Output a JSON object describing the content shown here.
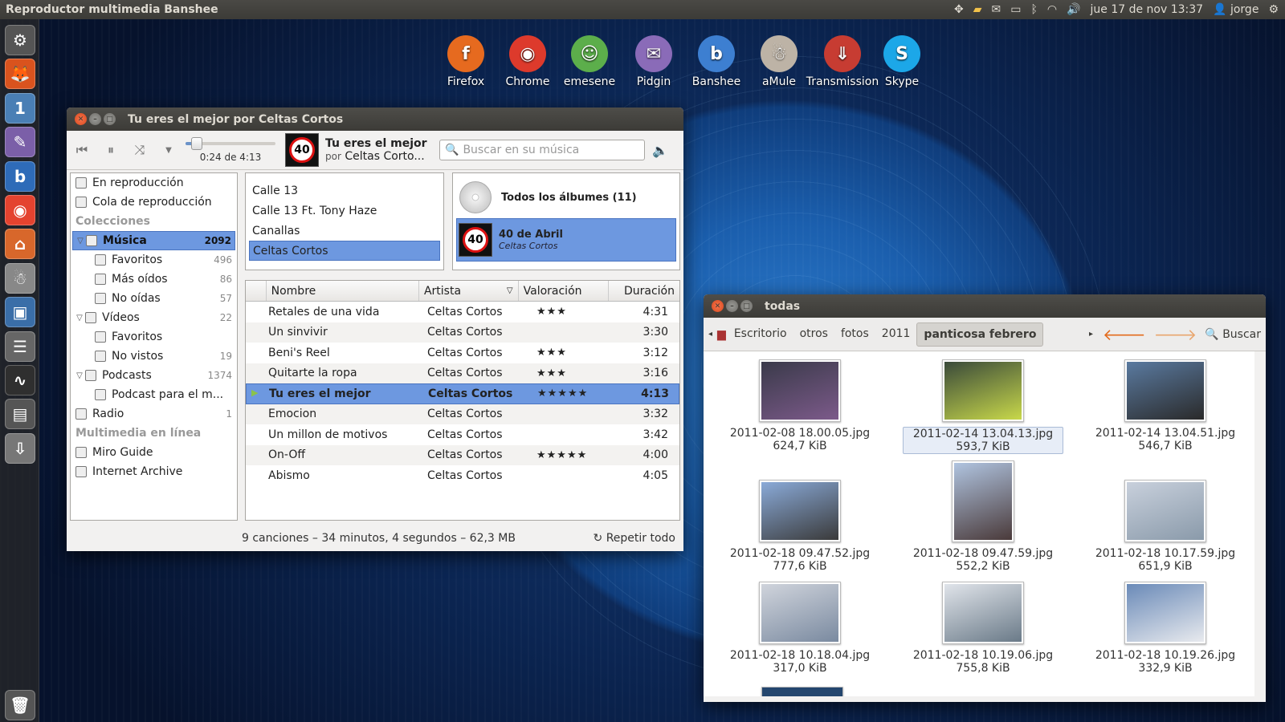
{
  "panel": {
    "app_name": "Reproductor multimedia Banshee",
    "datetime": "jue 17 de nov 13:37",
    "user": "jorge"
  },
  "launcher": {
    "items": [
      {
        "icon": "settings-icon",
        "glyph": "⚙",
        "color": "#555"
      },
      {
        "icon": "firefox-icon",
        "glyph": "🦊",
        "color": "#d9531e"
      },
      {
        "icon": "messaging-icon",
        "glyph": "1",
        "color": "#4a7fb5"
      },
      {
        "icon": "pidgin-icon",
        "glyph": "✎",
        "color": "#7b5fa8"
      },
      {
        "icon": "banshee-icon",
        "glyph": "b",
        "color": "#2e6bb8"
      },
      {
        "icon": "chrome-icon",
        "glyph": "◉",
        "color": "#e4432f"
      },
      {
        "icon": "home-folder-icon",
        "glyph": "⌂",
        "color": "#d8672b"
      },
      {
        "icon": "amule-icon",
        "glyph": "☃",
        "color": "#888"
      },
      {
        "icon": "screenshot-icon",
        "glyph": "▣",
        "color": "#3a6ea8"
      },
      {
        "icon": "disk-icon",
        "glyph": "☰",
        "color": "#666"
      },
      {
        "icon": "system-monitor-icon",
        "glyph": "∿",
        "color": "#2f2f2f"
      },
      {
        "icon": "terminal-icon",
        "glyph": "▤",
        "color": "#555"
      },
      {
        "icon": "installer-icon",
        "glyph": "⇩",
        "color": "#777"
      }
    ],
    "trash_icon": "trash-icon"
  },
  "desktop_icons": [
    {
      "label": "Firefox",
      "color": "#e66a1f",
      "glyph": "f"
    },
    {
      "label": "Chrome",
      "color": "#dd3a2c",
      "glyph": "◉"
    },
    {
      "label": "emesene",
      "color": "#5cae4b",
      "glyph": "☺"
    },
    {
      "label": "Pidgin",
      "color": "#8a6bb8",
      "glyph": "✉"
    },
    {
      "label": "Banshee",
      "color": "#3d7fd1",
      "glyph": "b"
    },
    {
      "label": "aMule",
      "color": "#bdb3a6",
      "glyph": "☃"
    },
    {
      "label": "Transmission",
      "color": "#c73c32",
      "glyph": "⇓"
    },
    {
      "label": "Skype",
      "color": "#1ca7e8",
      "glyph": "S"
    }
  ],
  "banshee": {
    "title": "Tu eres el mejor por Celtas Cortos",
    "now_playing": {
      "title": "Tu eres el mejor",
      "by": "por",
      "artist": "Celtas Corto...",
      "time": "0:24 de 4:13",
      "progress": 0.095,
      "cover": "40"
    },
    "search_placeholder": "Buscar en su música",
    "sources": [
      {
        "label": "En reproducción",
        "level": 0,
        "count": "",
        "type": "item"
      },
      {
        "label": "Cola de reproducción",
        "level": 0,
        "count": "",
        "type": "item"
      },
      {
        "label": "Colecciones",
        "level": 0,
        "count": "",
        "type": "header"
      },
      {
        "label": "Música",
        "level": 0,
        "count": "2092",
        "type": "sel",
        "expander": "▽"
      },
      {
        "label": "Favoritos",
        "level": 1,
        "count": "496",
        "type": "item"
      },
      {
        "label": "Más oídos",
        "level": 1,
        "count": "86",
        "type": "item"
      },
      {
        "label": "No oídas",
        "level": 1,
        "count": "57",
        "type": "item"
      },
      {
        "label": "Vídeos",
        "level": 0,
        "count": "22",
        "type": "item",
        "expander": "▽"
      },
      {
        "label": "Favoritos",
        "level": 1,
        "count": "",
        "type": "item"
      },
      {
        "label": "No vistos",
        "level": 1,
        "count": "19",
        "type": "item"
      },
      {
        "label": "Podcasts",
        "level": 0,
        "count": "1374",
        "type": "item",
        "expander": "▽"
      },
      {
        "label": "Podcast para el m...",
        "level": 1,
        "count": "",
        "type": "item"
      },
      {
        "label": "Radio",
        "level": 0,
        "count": "1",
        "type": "item"
      },
      {
        "label": "Multimedia en línea",
        "level": 0,
        "count": "",
        "type": "header"
      },
      {
        "label": "Miro Guide",
        "level": 0,
        "count": "",
        "type": "item"
      },
      {
        "label": "Internet Archive",
        "level": 0,
        "count": "",
        "type": "item"
      }
    ],
    "artists": [
      "Calle 13",
      "Calle 13 Ft. Tony Haze",
      "Canallas",
      "Celtas Cortos"
    ],
    "albums": {
      "all": "Todos los álbumes (11)",
      "selected_title": "40 de Abril",
      "selected_artist": "Celtas Cortos"
    },
    "columns": [
      "Nombre",
      "Artista",
      "Valoración",
      "Duración"
    ],
    "tracks": [
      {
        "name": "Retales de una vida",
        "artist": "Celtas Cortos",
        "rating": "★★★",
        "duration": "4:31"
      },
      {
        "name": "Un sinvivir",
        "artist": "Celtas Cortos",
        "rating": "",
        "duration": "3:30"
      },
      {
        "name": "Beni's Reel",
        "artist": "Celtas Cortos",
        "rating": "★★★",
        "duration": "3:12"
      },
      {
        "name": "Quitarte la ropa",
        "artist": "Celtas Cortos",
        "rating": "★★★",
        "duration": "3:16"
      },
      {
        "name": "Tu eres el mejor",
        "artist": "Celtas Cortos",
        "rating": "★★★★★",
        "duration": "4:13",
        "playing": true
      },
      {
        "name": "Emocion",
        "artist": "Celtas Cortos",
        "rating": "",
        "duration": "3:32"
      },
      {
        "name": "Un millon de motivos",
        "artist": "Celtas Cortos",
        "rating": "",
        "duration": "3:42"
      },
      {
        "name": "On-Off",
        "artist": "Celtas Cortos",
        "rating": "★★★★★",
        "duration": "4:00"
      },
      {
        "name": "Abismo",
        "artist": "Celtas Cortos",
        "rating": "",
        "duration": "4:05"
      }
    ],
    "status": "9 canciones – 34 minutos, 4 segundos – 62,3 MB",
    "repeat": "Repetir todo"
  },
  "nautilus": {
    "title": "todas",
    "breadcrumbs": [
      "Escritorio",
      "otros",
      "fotos",
      "2011",
      "panticosa febrero"
    ],
    "search_label": "Buscar",
    "files": [
      {
        "name": "2011-02-08 18.00.05.jpg",
        "size": "624,7 KiB",
        "colors": "#3a3a4a,#7c5a8a"
      },
      {
        "name": "2011-02-14 13.04.13.jpg",
        "size": "593,7 KiB",
        "colors": "#3a4a3a,#c8d84a",
        "selected": true
      },
      {
        "name": "2011-02-14 13.04.51.jpg",
        "size": "546,7 KiB",
        "colors": "#5a7aa0,#2a2a2a"
      },
      {
        "name": "2011-02-18 09.47.52.jpg",
        "size": "777,6 KiB",
        "colors": "#8aaad8,#3a3a3a"
      },
      {
        "name": "2011-02-18 09.47.59.jpg",
        "size": "552,2 KiB",
        "colors": "#b0c4e0,#4a3a3a"
      },
      {
        "name": "2011-02-18 10.17.59.jpg",
        "size": "651,9 KiB",
        "colors": "#c8d0dc,#8a9aaa"
      },
      {
        "name": "2011-02-18 10.18.04.jpg",
        "size": "317,0 KiB",
        "colors": "#d0d4dc,#7a8aa0"
      },
      {
        "name": "2011-02-18 10.19.06.jpg",
        "size": "755,8 KiB",
        "colors": "#e0e4ea,#6a7a88"
      },
      {
        "name": "2011-02-18 10.19.26.jpg",
        "size": "332,9 KiB",
        "colors": "#6a8ab8,#e8eaee"
      }
    ]
  }
}
